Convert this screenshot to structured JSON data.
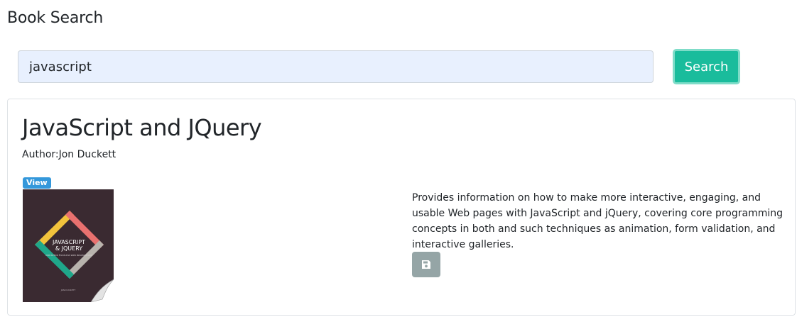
{
  "page": {
    "heading": "Book Search"
  },
  "search": {
    "value": "javascript",
    "button_label": "Search"
  },
  "result": {
    "title": "JavaScript and JQuery",
    "author": "Author:Jon Duckett",
    "view_label": "View",
    "cover": {
      "line1": "JAVASCRIPT",
      "line2": "& JQUERY",
      "subtitle": "interactive front-end web development",
      "author": "JON DUCKETT",
      "bg_color": "#3a2a31"
    },
    "description": "Provides information on how to make more interactive, engaging, and usable Web pages with JavaScript and jQuery, covering core programming concepts in both and such techniques as animation, form validation, and interactive galleries.",
    "save_icon": "floppy-disk-icon"
  },
  "colors": {
    "accent": "#1abc9c",
    "badge": "#3498db",
    "save_button": "#95a5a6"
  }
}
